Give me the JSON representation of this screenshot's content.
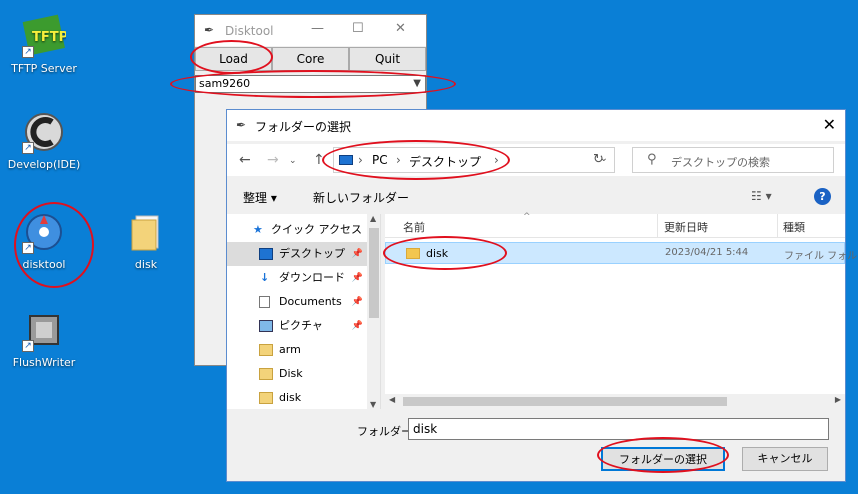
{
  "desktop": {
    "icons": [
      {
        "label": "TFTP Server"
      },
      {
        "label": "Develop(IDE)"
      },
      {
        "label": "disktool"
      },
      {
        "label": "disk"
      },
      {
        "label": "FlushWriter"
      }
    ],
    "tftp_logo_text": "TFTP"
  },
  "disktool": {
    "title": "Disktool",
    "buttons": {
      "load": "Load",
      "core": "Core",
      "quit": "Quit"
    },
    "selected_target": "sam9260"
  },
  "dialog": {
    "title": "フォルダーの選択",
    "breadcrumb": [
      "PC",
      "デスクトップ"
    ],
    "search_placeholder": "デスクトップの検索",
    "organize_label": "整理 ▾",
    "new_folder_label": "新しいフォルダー",
    "nav_items": [
      {
        "label": "クイック アクセス"
      },
      {
        "label": "デスクトップ"
      },
      {
        "label": "ダウンロード"
      },
      {
        "label": "Documents"
      },
      {
        "label": "ピクチャ"
      },
      {
        "label": "arm"
      },
      {
        "label": "Disk"
      },
      {
        "label": "disk"
      }
    ],
    "columns": {
      "name": "名前",
      "date": "更新日時",
      "type": "種類"
    },
    "files": [
      {
        "name": "disk",
        "date": "2023/04/21 5:44",
        "type": "ファイル フォルダー"
      }
    ],
    "folder_label": "フォルダー:",
    "folder_value": "disk",
    "select_button": "フォルダーの選択",
    "cancel_button": "キャンセル"
  },
  "colors": {
    "desktop": "#0a7fd6",
    "annotation": "#e0101e",
    "selection": "#cce8ff"
  }
}
